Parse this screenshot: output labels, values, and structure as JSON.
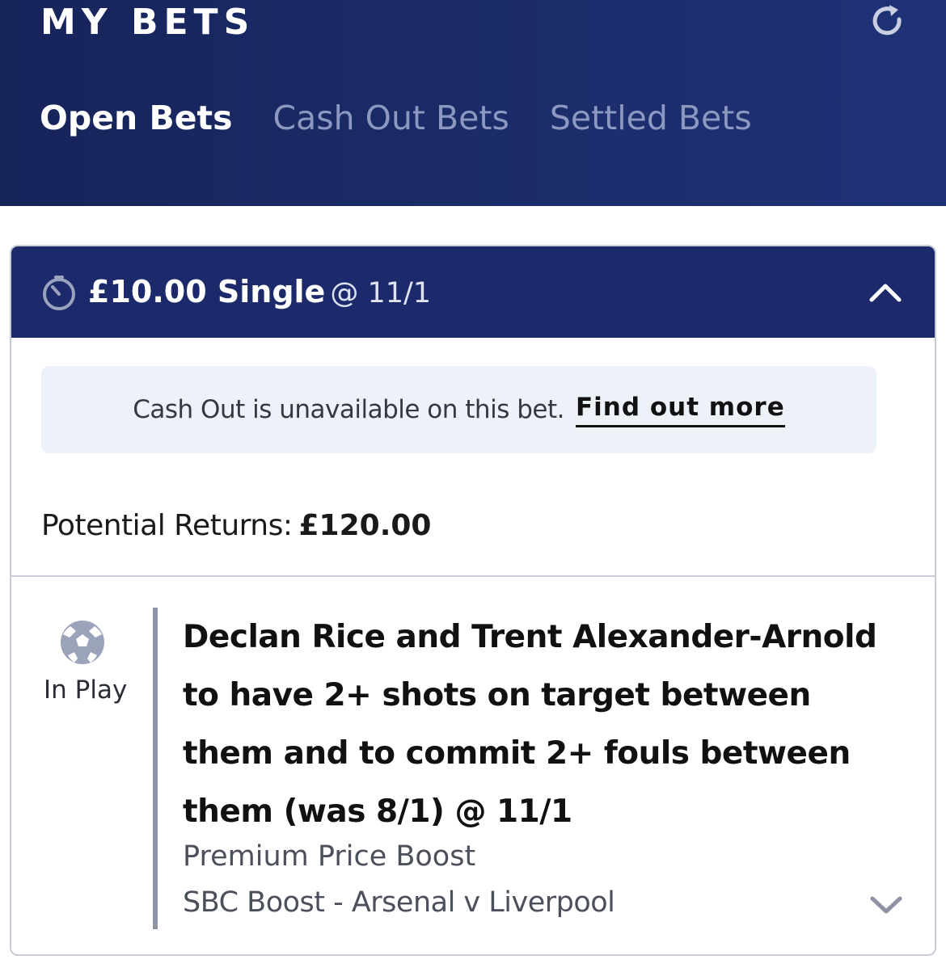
{
  "header": {
    "title": "MY BETS",
    "refresh_icon": "refresh-icon",
    "tabs": [
      {
        "label": "Open Bets",
        "active": true
      },
      {
        "label": "Cash Out Bets",
        "active": false
      },
      {
        "label": "Settled Bets",
        "active": false
      }
    ]
  },
  "bet": {
    "stake_type": "£10.00 Single",
    "odds": "@ 11/1",
    "timer_icon": "timer-icon",
    "collapse_icon": "chevron-up-icon",
    "cashout_notice": {
      "text": "Cash Out is unavailable on this bet.",
      "link_label": "Find out more"
    },
    "potential_returns": {
      "label": "Potential Returns:",
      "value": "£120.00"
    },
    "selection": {
      "status_icon": "football-icon",
      "status": "In Play",
      "title": "Declan Rice and Trent Alexander-Arnold to have 2+ shots on target between them and to commit 2+ fouls between them (was 8/1) @ 11/1",
      "boost_type": "Premium Price Boost",
      "event": "SBC Boost - Arsenal v Liverpool",
      "expand_icon": "chevron-down-icon"
    }
  },
  "colors": {
    "header_bg": "#1c2d6c",
    "card_header_bg": "#1c2a6b",
    "notice_bg": "#edf1f8",
    "inactive_tab": "#8c98c0"
  }
}
